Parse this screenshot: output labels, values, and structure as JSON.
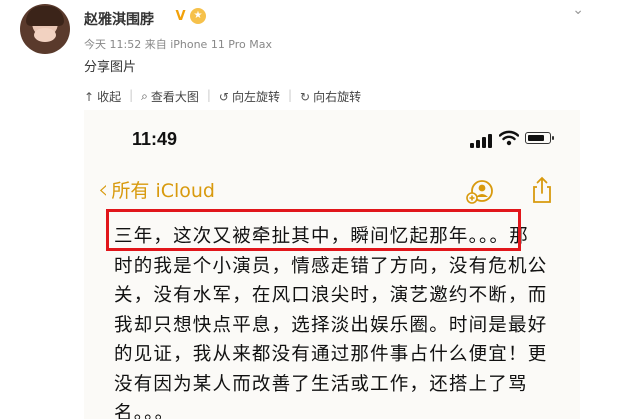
{
  "post": {
    "username": "赵雅淇围脖",
    "verified_badge": "V",
    "medal_icon": "medal-icon",
    "more_icon": "chevron-down-icon",
    "meta": "今天 11:52 来自 iPhone 11 Pro Max",
    "caption": "分享图片"
  },
  "toolbar": {
    "items": [
      {
        "icon": "collapse-icon",
        "label": "收起"
      },
      {
        "icon": "search-icon",
        "label": "查看大图"
      },
      {
        "icon": "rotate-left-icon",
        "label": "向左旋转"
      },
      {
        "icon": "rotate-right-icon",
        "label": "向右旋转"
      }
    ]
  },
  "screenshot": {
    "time": "11:49",
    "battery_level": 0.8,
    "back_label": "所有 iCloud",
    "note_lines": [
      "三年，这次又被牵扯其中，瞬间忆起那年。。。那",
      "时的我是个小演员，情感走错了方向，没有危机公",
      "关，没有水军，在风口浪尖时，演艺邀约不断，而",
      "我却只想快点平息，选择淡出娱乐圈。时间是最好",
      "的见证，我从来都没有通过那件事占什么便宜！更",
      "没有因为某人而改善了生活或工作，还搭上了骂",
      "名。。。"
    ]
  },
  "colors": {
    "accent": "#d89a0e",
    "highlight_border": "#e1161b",
    "badge": "#f2a10a"
  }
}
